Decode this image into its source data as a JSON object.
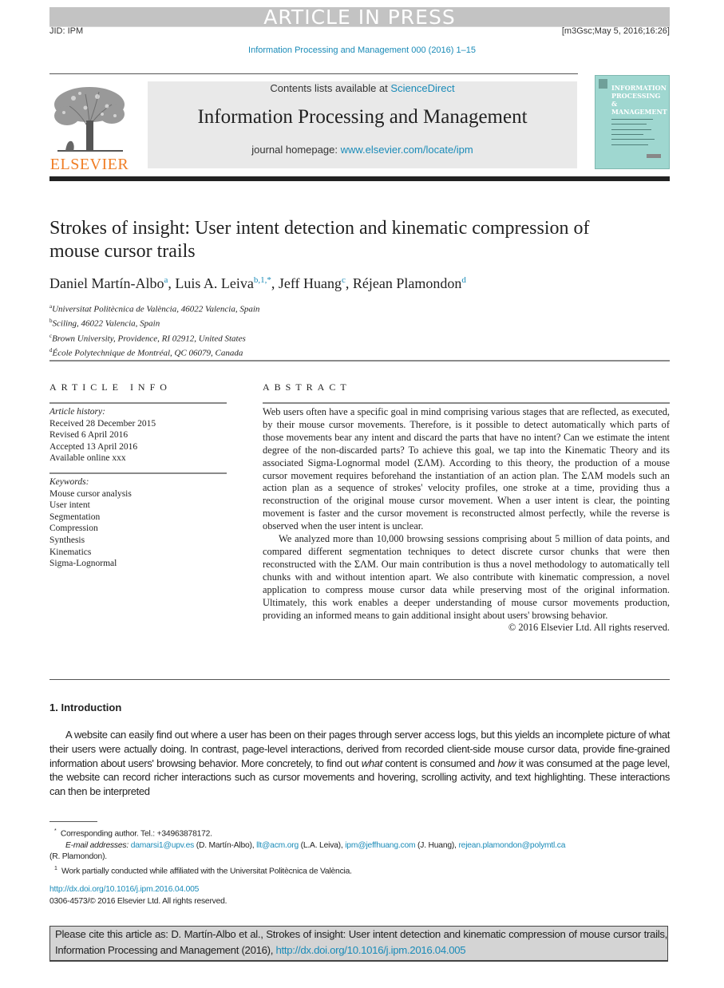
{
  "header": {
    "banner": "ARTICLE IN PRESS",
    "jid": "JID: IPM",
    "stamp": "[m3Gsc;May 5, 2016;16:26]",
    "journal_ref": "Information Processing and Management 000 (2016) 1–15"
  },
  "masthead": {
    "publisher_logo_text": "ELSEVIER",
    "contents_prefix": "Contents lists available at ",
    "contents_link": "ScienceDirect",
    "journal_title": "Information Processing and Management",
    "homepage_prefix": "journal homepage: ",
    "homepage_link": "www.elsevier.com/locate/ipm",
    "cover_title_lines": [
      "INFORMATION",
      "PROCESSING",
      "&",
      "MANAGEMENT"
    ]
  },
  "article": {
    "title": "Strokes of insight: User intent detection and kinematic compression of mouse cursor trails",
    "authors": [
      {
        "name": "Daniel Martín-Albo",
        "marks": "a"
      },
      {
        "name": "Luis A. Leiva",
        "marks": "b,1,*"
      },
      {
        "name": "Jeff Huang",
        "marks": "c"
      },
      {
        "name": "Réjean Plamondon",
        "marks": "d"
      }
    ],
    "affiliations": [
      {
        "mark": "a",
        "text": "Universitat Politècnica de València, 46022 Valencia, Spain"
      },
      {
        "mark": "b",
        "text": "Sciling, 46022 Valencia, Spain"
      },
      {
        "mark": "c",
        "text": "Brown University, Providence, RI 02912, United States"
      },
      {
        "mark": "d",
        "text": "École Polytechnique de Montréal, QC 06079, Canada"
      }
    ]
  },
  "article_info": {
    "heading": "ARTICLE INFO",
    "history_label": "Article history:",
    "history": [
      "Received 28 December 2015",
      "Revised 6 April 2016",
      "Accepted 13 April 2016",
      "Available online xxx"
    ],
    "keywords_label": "Keywords:",
    "keywords": [
      "Mouse cursor analysis",
      "User intent",
      "Segmentation",
      "Compression",
      "Synthesis",
      "Kinematics",
      "Sigma-Lognormal"
    ]
  },
  "abstract": {
    "heading": "ABSTRACT",
    "paragraphs": [
      "Web users often have a specific goal in mind comprising various stages that are reflected, as executed, by their mouse cursor movements. Therefore, is it possible to detect automatically which parts of those movements bear any intent and discard the parts that have no intent? Can we estimate the intent degree of the non-discarded parts? To achieve this goal, we tap into the Kinematic Theory and its associated Sigma-Lognormal model (ΣΛM). According to this theory, the production of a mouse cursor movement requires beforehand the instantiation of an action plan. The ΣΛM models such an action plan as a sequence of strokes' velocity profiles, one stroke at a time, providing thus a reconstruction of the original mouse cursor movement. When a user intent is clear, the pointing movement is faster and the cursor movement is reconstructed almost perfectly, while the reverse is observed when the user intent is unclear.",
      "We analyzed more than 10,000 browsing sessions comprising about 5 million of data points, and compared different segmentation techniques to detect discrete cursor chunks that were then reconstructed with the ΣΛM. Our main contribution is thus a novel methodology to automatically tell chunks with and without intention apart. We also contribute with kinematic compression, a novel application to compress mouse cursor data while preserving most of the original information. Ultimately, this work enables a deeper understanding of mouse cursor movements production, providing an informed means to gain additional insight about users' browsing behavior."
    ],
    "copyright": "© 2016 Elsevier Ltd. All rights reserved."
  },
  "introduction": {
    "heading": "1. Introduction",
    "p1_a": "A website can easily find out where a user has been on their pages through server access logs, but this yields an incomplete picture of what their users were actually doing. In contrast, page-level interactions, derived from recorded client-side mouse cursor data, provide fine-grained information about users' browsing behavior. More concretely, to find out ",
    "p1_em1": "what",
    "p1_b": " content is consumed and ",
    "p1_em2": "how",
    "p1_c": " it was consumed at the page level, the website can record richer interactions such as cursor movements and hovering, scrolling activity, and text highlighting. These interactions can then be interpreted"
  },
  "footnotes": {
    "corresponding": "Corresponding author. Tel.: +34963878172.",
    "corresponding_mark": "*",
    "email_label": "E-mail addresses:",
    "emails": [
      {
        "address": "damarsi1@upv.es",
        "owner": " (D. Martín-Albo), "
      },
      {
        "address": "llt@acm.org",
        "owner": " (L.A. Leiva), "
      },
      {
        "address": "ipm@jeffhuang.com",
        "owner": " (J. Huang), "
      },
      {
        "address": "rejean.plamondon@polymtl.ca",
        "owner": ""
      }
    ],
    "email_tail": "(R. Plamondon).",
    "note1_mark": "1",
    "note1": "Work partially conducted while affiliated with the Universitat Politècnica de València.",
    "doi_link": "http://dx.doi.org/10.1016/j.ipm.2016.04.005",
    "issn": "0306-4573/© 2016 Elsevier Ltd. All rights reserved."
  },
  "citation": {
    "text": "Please cite this article as: D. Martín-Albo et al., Strokes of insight: User intent detection and kinematic compression of mouse cursor trails, Information Processing and Management (2016), ",
    "link": "http://dx.doi.org/10.1016/j.ipm.2016.04.005"
  },
  "colors": {
    "link": "#1a8bb8",
    "elsevier_orange": "#f07e26",
    "banner_grey": "#c3c3c3",
    "cover_teal": "#9fd7d0"
  }
}
